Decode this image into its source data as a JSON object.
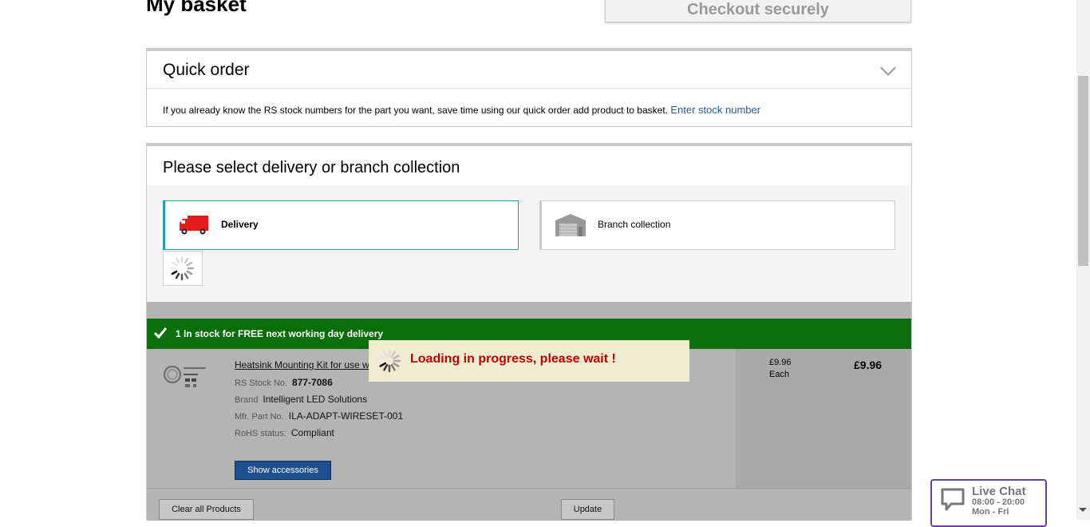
{
  "header": {
    "title": "My basket",
    "checkout_label": "Checkout securely"
  },
  "quick_order": {
    "title": "Quick order",
    "description": "If you already know the RS stock numbers for the part you want, save time using our quick order add product to basket.",
    "link_label": "Enter stock number"
  },
  "delivery": {
    "title": "Please select delivery or branch collection",
    "options": [
      {
        "label": "Delivery",
        "icon": "truck-icon",
        "selected": true
      },
      {
        "label": "Branch collection",
        "icon": "warehouse-icon",
        "selected": false
      }
    ]
  },
  "stock_banner": "1 In stock for FREE next working day delivery",
  "item": {
    "name": "Heatsink Mounting Kit for use w",
    "stock_no_label": "RS Stock No.",
    "stock_no": "877-7086",
    "brand_label": "Brand",
    "brand": "Intelligent LED Solutions",
    "mfr_label": "Mfr. Part No.",
    "mfr": "ILA-ADAPT-WIRESET-001",
    "rohs_label": "RoHS status:",
    "rohs": "Compliant",
    "accessories_label": "Show accessories",
    "unit_price": "£9.96",
    "unit_label": "Each",
    "total_price": "£9.96"
  },
  "footer": {
    "clear_label": "Clear all Products",
    "update_label": "Update"
  },
  "loading": {
    "text": "Loading in progress, please wait !"
  },
  "live_chat": {
    "title": "Live Chat",
    "hours": "08:00 - 20:00",
    "days": "Mon - Fri"
  },
  "colors": {
    "accent": "#1fa0b4",
    "stock_green": "#0a6e0a",
    "loading_red": "#c00000",
    "chat_purple": "#6b3fa0",
    "button_blue": "#1f4f8f"
  }
}
